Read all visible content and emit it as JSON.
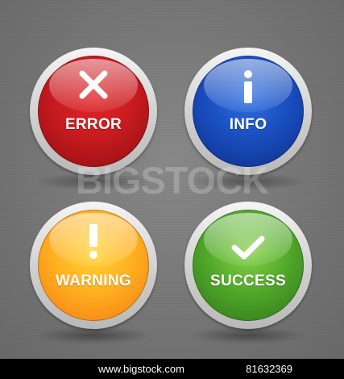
{
  "badges": [
    {
      "label": "ERROR",
      "symbol": "x-mark",
      "color": "#c81b20"
    },
    {
      "label": "INFO",
      "symbol": "info-i",
      "color": "#1a4fc0"
    },
    {
      "label": "WARNING",
      "symbol": "exclamation-mark",
      "color": "#ffb020"
    },
    {
      "label": "SUCCESS",
      "symbol": "check-mark",
      "color": "#52a92a"
    }
  ],
  "watermark": "BIGSTOCK",
  "footer": {
    "site": "www.bigstock.com",
    "image_id": "81632369"
  }
}
